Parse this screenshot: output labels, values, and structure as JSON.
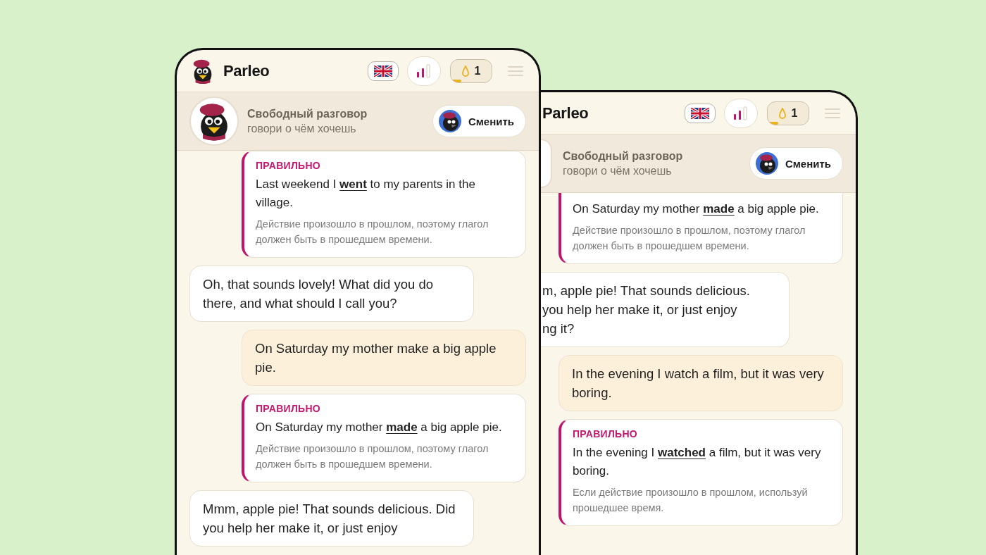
{
  "phones": [
    {
      "header": {
        "brand": "Parleo",
        "streak": {
          "count": "1",
          "level": 0.25
        }
      },
      "topic": {
        "title": "Свободный разговор",
        "subtitle": "говори о чём хочешь",
        "change_button": "Сменить"
      },
      "messages": [
        {
          "kind": "correction",
          "label": "ПРАВИЛЬНО",
          "sentence": "Last weekend I **went** to my parents in the village.",
          "explanation": "Действие произошло в прошлом, поэтому глагол должен быть в прошедшем времени."
        },
        {
          "kind": "bot",
          "text": "Oh, that sounds lovely! What did you do there, and what should I call you?"
        },
        {
          "kind": "user",
          "text": "On Saturday my mother make a big apple pie."
        },
        {
          "kind": "correction",
          "label": "ПРАВИЛЬНО",
          "sentence": "On Saturday my mother **made** a big apple pie.",
          "explanation": "Действие произошло в прошлом, поэтому глагол должен быть в прошедшем времени."
        },
        {
          "kind": "bot",
          "text": "Mmm, apple pie! That sounds delicious. Did you help her make it, or just enjoy"
        }
      ]
    },
    {
      "header": {
        "brand": "Parleo",
        "streak": {
          "count": "1",
          "level": 0.25
        }
      },
      "topic": {
        "title": "Свободный разговор",
        "subtitle": "говори о чём хочешь",
        "change_button": "Сменить"
      },
      "messages": [
        {
          "kind": "correction",
          "sentence": "On Saturday my mother **made** a big apple pie.",
          "explanation": "Действие произошло в прошлом, поэтому глагол должен быть в прошедшем времени."
        },
        {
          "kind": "bot",
          "text": "m, apple pie! That sounds delicious.\nyou help her make it, or just enjoy\nng it?"
        },
        {
          "kind": "user",
          "text": "In the evening I watch a film, but it was very boring."
        },
        {
          "kind": "correction",
          "label": "ПРАВИЛЬНО",
          "sentence": "In the evening I **watched** a film, but it was very boring.",
          "explanation": "Если действие произошло в прошлом, используй прошедшее время."
        }
      ]
    }
  ]
}
